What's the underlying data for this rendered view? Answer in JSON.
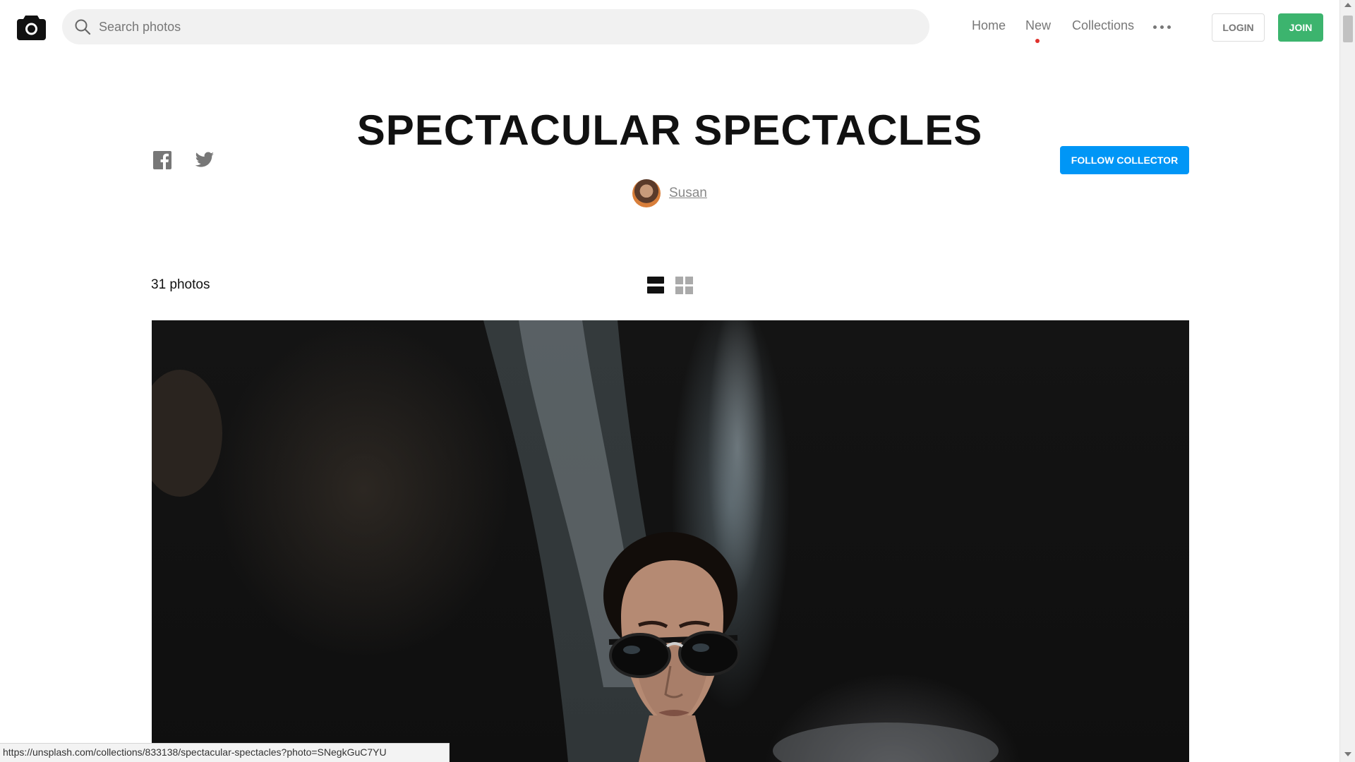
{
  "header": {
    "search_placeholder": "Search photos",
    "nav": {
      "home": "Home",
      "new": "New",
      "collections": "Collections"
    },
    "login_label": "LOGIN",
    "join_label": "JOIN"
  },
  "collection": {
    "title": "SPECTACULAR SPECTACLES",
    "collector_name": "Susan",
    "follow_label": "FOLLOW COLLECTOR",
    "photo_count": "31 photos"
  },
  "status_url": "https://unsplash.com/collections/833138/spectacular-spectacles?photo=SNegkGuC7YU",
  "icons": {
    "logo": "camera-icon",
    "search": "search-icon",
    "more": "more-dots-icon",
    "facebook": "facebook-icon",
    "twitter": "twitter-icon",
    "list_view": "list-view-icon",
    "grid_view": "grid-view-icon"
  },
  "colors": {
    "join": "#3cb46e",
    "follow": "#0096f6",
    "new_dot": "#e0312c"
  }
}
